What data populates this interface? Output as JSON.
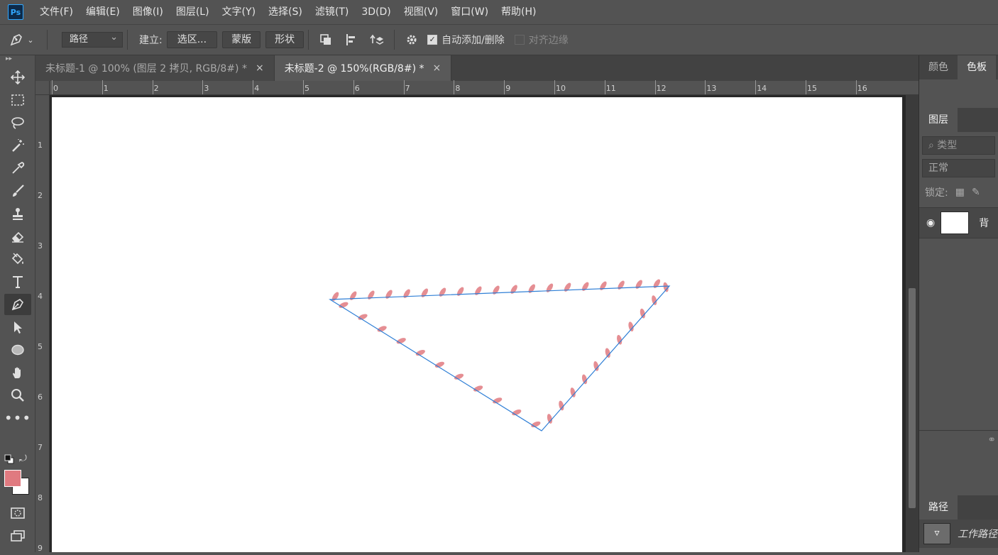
{
  "app": {
    "logo": "Ps"
  },
  "menu": [
    "文件(F)",
    "编辑(E)",
    "图像(I)",
    "图层(L)",
    "文字(Y)",
    "选择(S)",
    "滤镜(T)",
    "3D(D)",
    "视图(V)",
    "窗口(W)",
    "帮助(H)"
  ],
  "options": {
    "tool_icon": "pen-icon",
    "mode_select": "路径",
    "make_label": "建立:",
    "selection_btn": "选区...",
    "mask_btn": "蒙版",
    "shape_btn": "形状",
    "auto_add_delete": "自动添加/删除",
    "align_edges": "对齐边缘"
  },
  "tabs": [
    {
      "label": "未标题-1 @ 100% (图层 2 拷贝, RGB/8#) *",
      "close": "×"
    },
    {
      "label": "未标题-2 @ 150%(RGB/8#) *",
      "close": "×"
    }
  ],
  "ruler": {
    "h": [
      "0",
      "1",
      "2",
      "3",
      "4",
      "5",
      "6",
      "7",
      "8",
      "9",
      "10",
      "11",
      "12",
      "13",
      "14",
      "15",
      "16"
    ],
    "v": [
      "1",
      "2",
      "3",
      "4",
      "5",
      "6",
      "7",
      "8",
      "9"
    ]
  },
  "colors": {
    "foreground": "#e07a80",
    "background": "#ffffff",
    "path": "#2f7fd6",
    "stroke_marks": "#e07a80"
  },
  "panels": {
    "top_tabs": [
      "颜色",
      "色板"
    ],
    "layers_tab": "图层",
    "kind_field": "类型",
    "blend_mode": "正常",
    "lock_label": "锁定:",
    "layer_name": "背",
    "paths_tab": "路径",
    "path_name": "工作路径"
  }
}
